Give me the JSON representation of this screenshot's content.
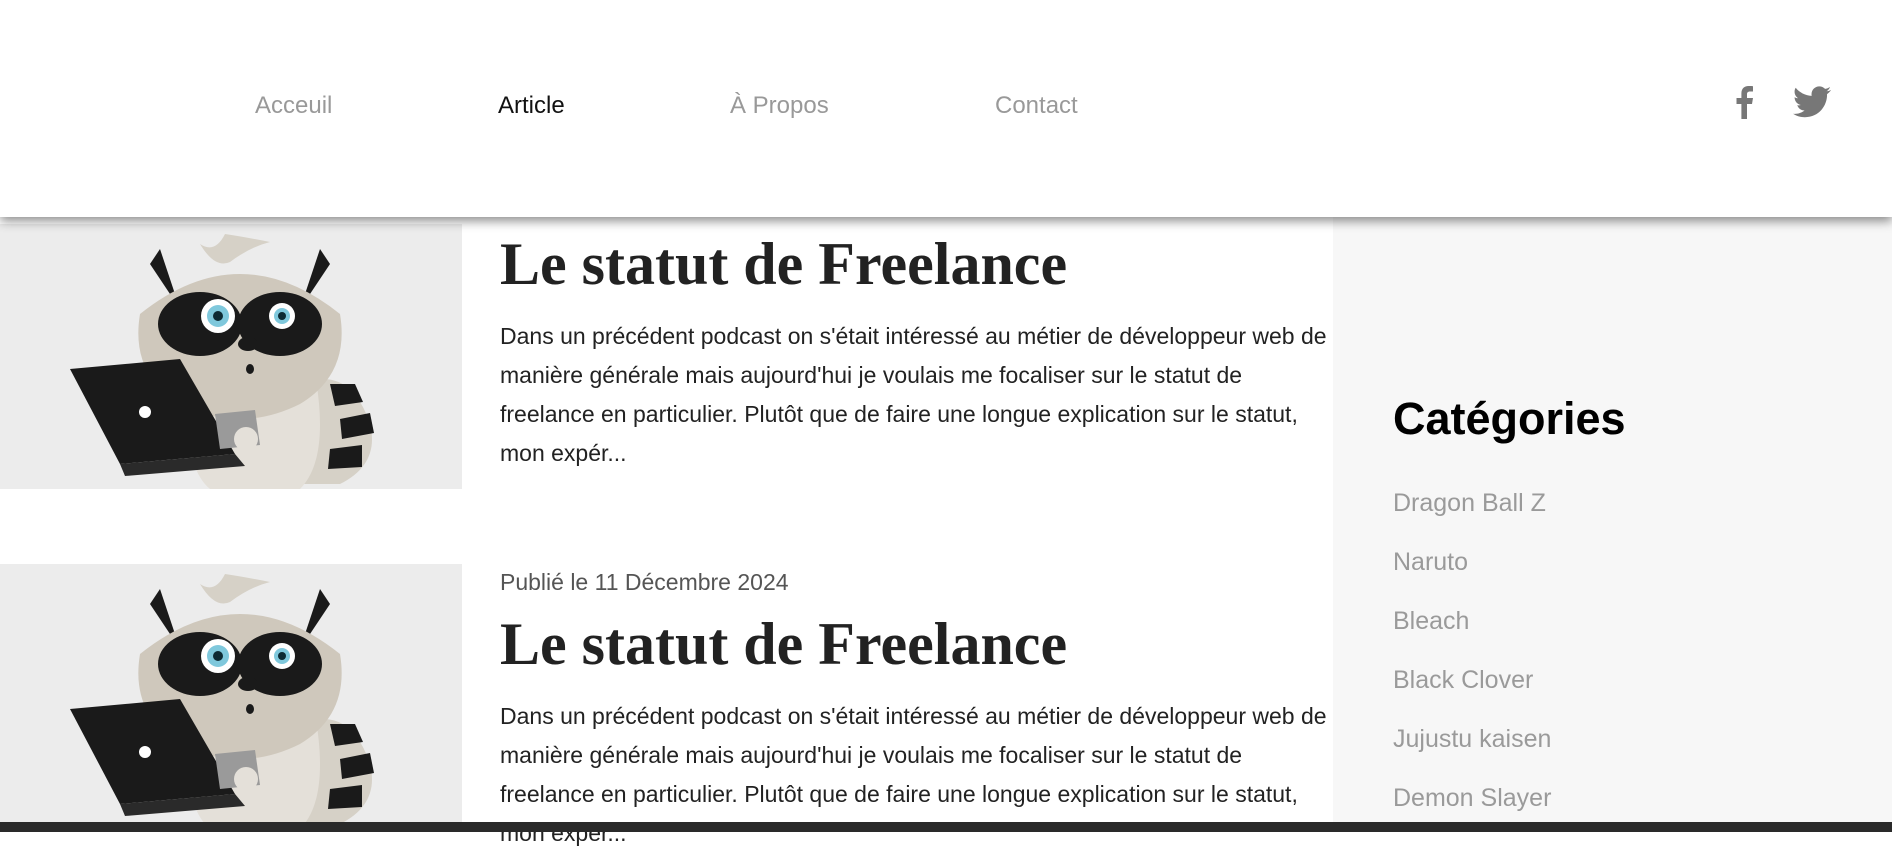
{
  "nav": {
    "items": [
      {
        "label": "Acceuil"
      },
      {
        "label": "Article"
      },
      {
        "label": "À Propos"
      },
      {
        "label": "Contact"
      }
    ]
  },
  "social": {
    "icons": [
      "facebook-icon",
      "twitter-icon"
    ],
    "color": "#777777"
  },
  "articles": [
    {
      "date": "",
      "title": "Le statut de Freelance",
      "excerpt": "Dans un précédent podcast on s'était intéressé au métier de développeur web de manière générale mais aujourd'hui je voulais me focaliser sur le statut de freelance en particulier. Plutôt que de faire une longue explication sur le statut, mon expér..."
    },
    {
      "date": "Publié le 11 Décembre 2024",
      "title": "Le statut de Freelance",
      "excerpt": "Dans un précédent podcast on s'était intéressé au métier de développeur web de manière générale mais aujourd'hui je voulais me focaliser sur le statut de freelance en particulier. Plutôt que de faire une longue explication sur le statut, mon expér..."
    }
  ],
  "sidebar": {
    "title": "Catégories",
    "categories": [
      {
        "label": "Dragon Ball Z"
      },
      {
        "label": "Naruto"
      },
      {
        "label": "Bleach"
      },
      {
        "label": "Black Clover"
      },
      {
        "label": "Jujustu kaisen"
      },
      {
        "label": "Demon Slayer"
      }
    ]
  },
  "colors": {
    "nav_inactive": "#999999",
    "nav_active": "#111111",
    "sidebar_bg": "#f7f7f7",
    "category_text": "#9a9a9a"
  }
}
